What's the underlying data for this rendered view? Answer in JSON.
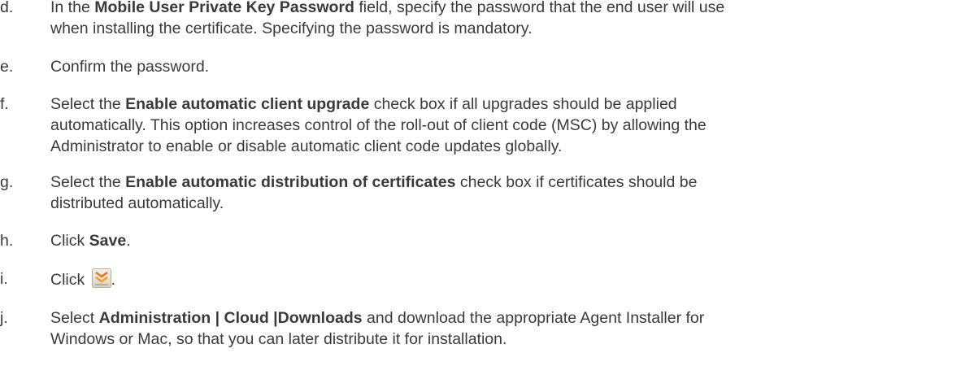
{
  "steps": [
    {
      "letter": "d.",
      "pre": "In the ",
      "bold": "Mobile User Private Key Password",
      "post": " field, specify the password that the end user will use",
      "line2": "when installing the certificate. Specifying the password is mandatory."
    },
    {
      "letter": "e.",
      "text": "Confirm the password."
    },
    {
      "letter": "f.",
      "pre": "Select the ",
      "bold": "Enable automatic client upgrade",
      "post": " check box if all upgrades should be applied",
      "line2": "automatically. This option increases control of the roll-out of client code (MSC) by allowing the",
      "line3": "Administrator to enable or disable automatic client code updates globally."
    },
    {
      "letter": "g.",
      "pre": "Select the ",
      "bold": "Enable automatic distribution of certificates",
      "post": " check box if certificates should be",
      "line2": "distributed automatically."
    },
    {
      "letter": "h.",
      "pre": "Click ",
      "bold": "Save",
      "post": "."
    },
    {
      "letter": "i.",
      "pre": "Click ",
      "icon": "collapse-chevrons-icon",
      "post": "."
    },
    {
      "letter": "j.",
      "pre": "Select ",
      "bold": "Administration | Cloud |Downloads",
      "post": " and download the appropriate Agent Installer for",
      "line2": "Windows or Mac, so that you can later distribute it for installation."
    }
  ]
}
